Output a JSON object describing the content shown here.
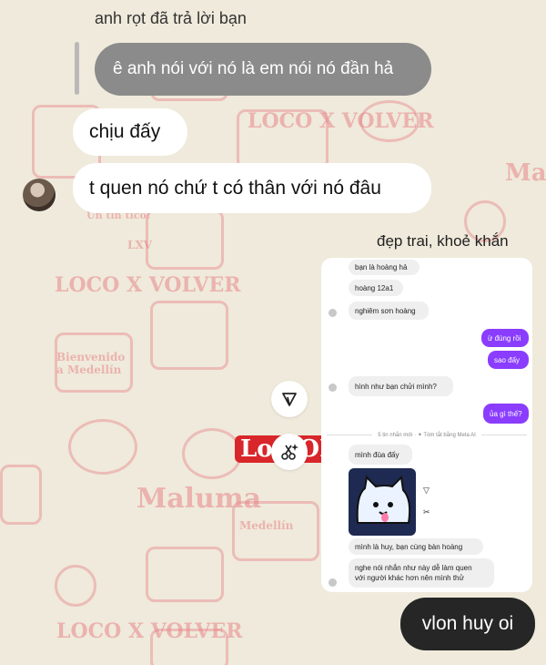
{
  "reply": {
    "header": "anh rọt đã trả lời bạn",
    "quoted": "ê anh nói với nó là em nói nó đần hả"
  },
  "messages": [
    "chịu đấy",
    "t quen nó chứ t có thân với nó đâu"
  ],
  "caption": "đẹp trai, khoẻ khắn",
  "screenshot": {
    "messages": [
      "bạn là hoàng hả",
      "hoàng 12a1",
      "nghiêm sơn hoàng",
      "ừ đúng rồi",
      "sao đấy",
      "hình như bạn chửi mình?",
      "ủa gì thế?",
      "mình đùa đấy",
      "mình là huy, bạn cùng bàn hoàng",
      "nghe nói nhắn như này dễ làm quen\nvới người khác hơn nên mình thử"
    ],
    "divider": "5 tin nhắn mới · ✦ Tóm tắt bằng Meta AI"
  },
  "outgoing": "vlon huy oi",
  "wallpaper": {
    "labels": [
      "LOCO X VOLVER",
      "Maluma",
      "Bienvenido a Medellín",
      "Un tin tico!",
      "LXV",
      "Maluma",
      "LOCO X VOLVER",
      "Medellín",
      "LOCO X VOLVER"
    ],
    "accent": "#e8868b"
  },
  "icons": {
    "send": "send-arrow-icon",
    "sparkle_scissors": "cutout-sparkle-icon"
  }
}
